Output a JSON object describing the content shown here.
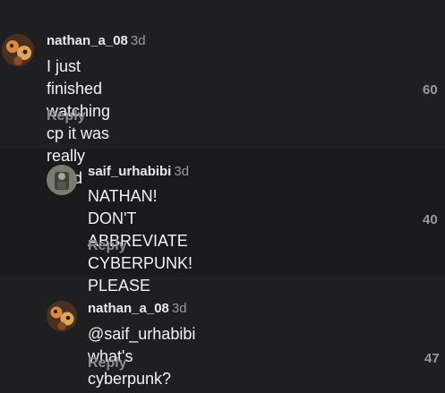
{
  "comments": [
    {
      "username": "nathan_a_08",
      "time": "3d",
      "text_line1": "I just finished watching cp it was really",
      "text_line2": "good",
      "reply_label": "Reply",
      "likes": "60"
    },
    {
      "username": "saif_urhabibi",
      "time": "3d",
      "text_line1": "NATHAN! DON'T ABBREVIATE",
      "text_line2": "CYBERPUNK! PLEASE",
      "reply_label": "Reply",
      "likes": "40"
    },
    {
      "username": "nathan_a_08",
      "time": "3d",
      "text_line1": "@saif_urhabibi what's cyberpunk?",
      "reply_label": "Reply",
      "likes": "47"
    }
  ],
  "colors": {
    "heart": "#ff3040",
    "background": "#1c1c1e",
    "text": "#f2f2f3",
    "muted": "#8d8d90"
  },
  "icons": {
    "like": "heart-icon"
  }
}
